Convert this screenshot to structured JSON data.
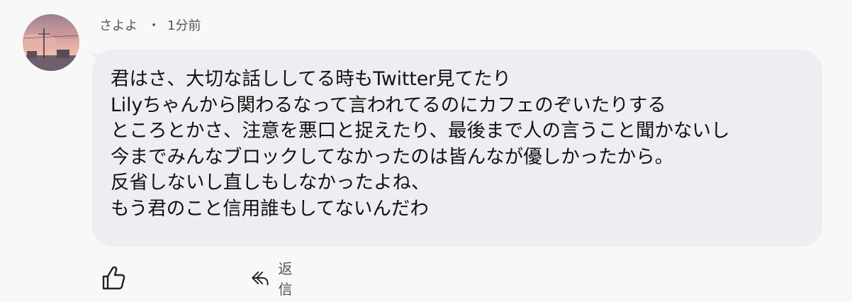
{
  "comment": {
    "author": "さよよ",
    "separator": "・",
    "time": "1分前",
    "lines": [
      "君はさ、大切な話ししてる時もTwitter見てたり",
      "Lilyちゃんから関わるなって言われてるのにカフェのぞいたりする",
      "ところとかさ、注意を悪口と捉えたり、最後まで人の言うこと聞かないし",
      "今までみんなブロックしてなかったのは皆んなが優しかったから。",
      "反省しないし直しもしなかったよね、",
      "もう君のこと信用誰もしてないんだわ"
    ]
  },
  "actions": {
    "like_icon": "thumbs-up-icon",
    "reply_icon": "reply-arrow-icon",
    "reply_label": "返信"
  },
  "colors": {
    "page_bg": "#f8f8f8",
    "bubble_bg": "#eceef1",
    "meta_text": "#555555"
  }
}
